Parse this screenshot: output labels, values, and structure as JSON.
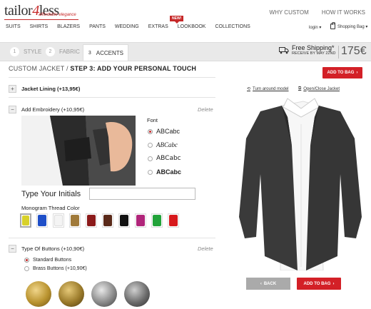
{
  "header": {
    "logo_main": "tailor",
    "logo_num": "4",
    "logo_end": "less",
    "tagline": "affordable elegance",
    "top_links": [
      "WHY CUSTOM",
      "HOW IT WORKS"
    ],
    "nav": [
      "SUITS",
      "SHIRTS",
      "BLAZERS",
      "PANTS",
      "WEDDING",
      "EXTRAS",
      "LOOKBOOK",
      "COLLECTIONS"
    ],
    "new_badge": "NEW!",
    "login": "login ▾",
    "bag": "Shopping Bag ▾"
  },
  "steps": [
    {
      "num": "1",
      "label": "STYLE"
    },
    {
      "num": "2",
      "label": "FABRIC"
    },
    {
      "num": "3",
      "label": "ACCENTS"
    }
  ],
  "shipping": {
    "title": "Free Shipping*",
    "subtitle": "RECEIVE BY MAY 22ND"
  },
  "price": "175€",
  "breadcrumb": {
    "first": "CUSTOM JACKET",
    "sep": "/",
    "current": "STEP 3: ADD YOUR PERSONAL TOUCH"
  },
  "add_to_bag": "ADD TO BAG",
  "links": {
    "turn": "Turn around model",
    "open": "Open/Close Jacket"
  },
  "sections": {
    "lining": "Jacket Lining (+13,95€)",
    "embroidery": "Add Embroidery (+10,95€)",
    "buttons": "Type Of Buttons (+10,90€)",
    "delete": "Delete"
  },
  "font": {
    "label": "Font",
    "options": [
      "ABCabc",
      "ABCabc",
      "ABCabc",
      "ABCabc"
    ],
    "selected": 0
  },
  "initials": {
    "label": "Type Your Initials",
    "value": ""
  },
  "thread": {
    "label": "Monogram Thread Color",
    "colors": [
      "#d8d12a",
      "#1f4fc8",
      "#f4f4f4",
      "#a07a3a",
      "#8b1a1a",
      "#5a2a1a",
      "#111111",
      "#b0257a",
      "#22a33a",
      "#d7191c"
    ],
    "selected": 0
  },
  "button_types": {
    "options": [
      "Standard Buttons",
      "Brass Buttons (+10,90€)"
    ],
    "selected": 0,
    "swatches": [
      "#b9932f",
      "#9a7a2a",
      "#8a8a8a",
      "#6b6b6b"
    ]
  },
  "back": "BACK"
}
